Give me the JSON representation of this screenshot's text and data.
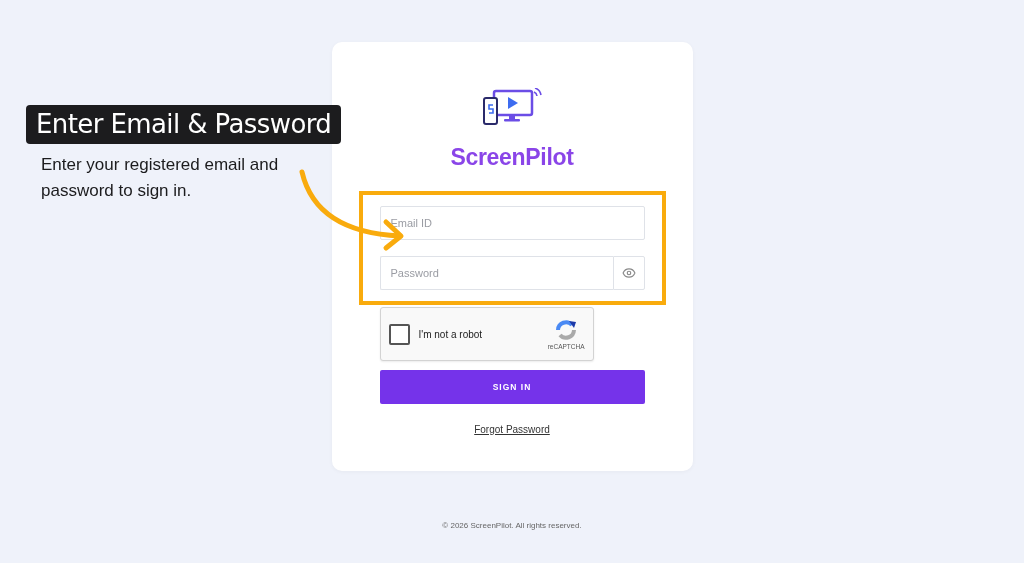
{
  "annotation": {
    "title": "Enter Email & Password",
    "description": "Enter your registered email and password to sign in."
  },
  "brand": {
    "name": "ScreenPilot"
  },
  "form": {
    "email": {
      "placeholder": "Email ID"
    },
    "password": {
      "placeholder": "Password"
    },
    "captcha": {
      "label": "I'm not a robot",
      "checked": false,
      "brand": "reCAPTCHA"
    },
    "submit": "SIGN IN",
    "forgot_link": "Forgot Password"
  },
  "footer": "© 2026 ScreenPilot. All rights reserved."
}
